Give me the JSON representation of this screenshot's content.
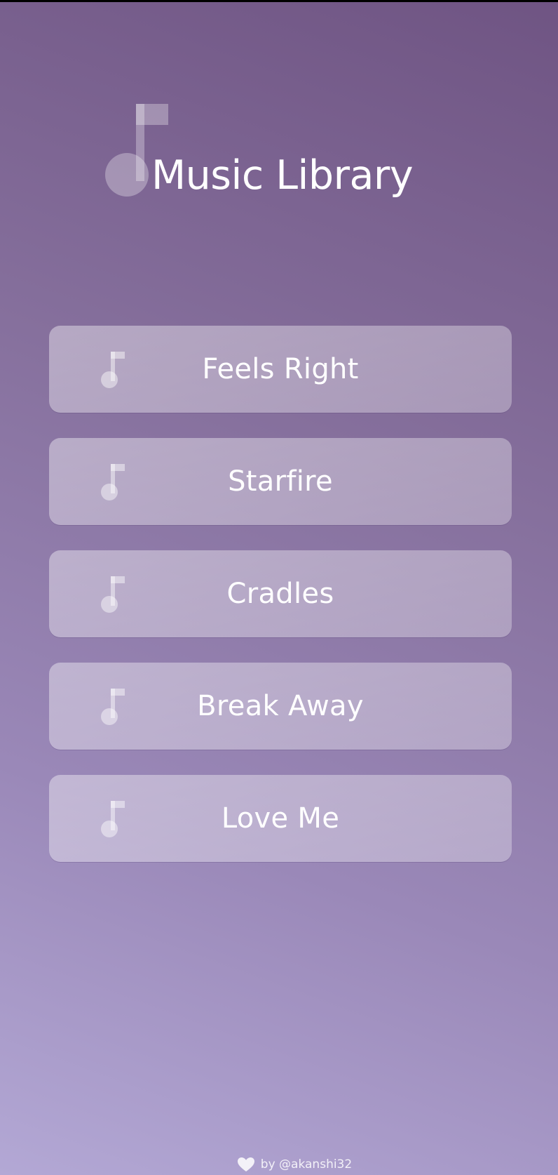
{
  "app": {
    "title": "Music Library",
    "icon": "music-note-icon"
  },
  "songs": [
    {
      "title": "Feels Right",
      "icon": "music-note-icon"
    },
    {
      "title": "Starfire",
      "icon": "music-note-icon"
    },
    {
      "title": "Cradles",
      "icon": "music-note-icon"
    },
    {
      "title": "Break Away",
      "icon": "music-note-icon"
    },
    {
      "title": "Love Me",
      "icon": "music-note-icon"
    }
  ],
  "footer": {
    "credit": "by @akanshi32",
    "icon": "heart-icon"
  },
  "colors": {
    "gradient_top": "#6f5483",
    "gradient_bottom": "#b3a8d5",
    "text": "#ffffff"
  }
}
